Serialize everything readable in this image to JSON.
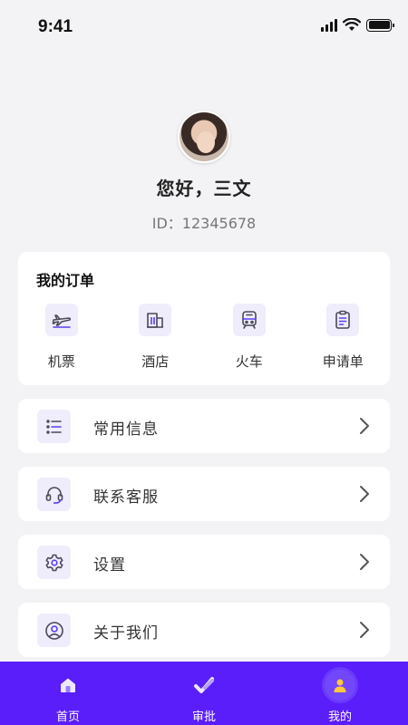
{
  "status_bar": {
    "time": "9:41"
  },
  "profile": {
    "greeting": "您好，三文",
    "id_text": "ID：12345678"
  },
  "orders": {
    "title": "我的订单",
    "items": [
      {
        "label": "机票",
        "icon": "airplane-icon"
      },
      {
        "label": "酒店",
        "icon": "hotel-building-icon"
      },
      {
        "label": "火车",
        "icon": "train-icon"
      },
      {
        "label": "申请单",
        "icon": "clipboard-icon"
      }
    ]
  },
  "menu": [
    {
      "label": "常用信息",
      "icon": "list-icon"
    },
    {
      "label": "联系客服",
      "icon": "headset-icon"
    },
    {
      "label": "设置",
      "icon": "gear-icon"
    },
    {
      "label": "关于我们",
      "icon": "user-circle-icon"
    }
  ],
  "tabs": [
    {
      "label": "首页",
      "icon": "home-icon",
      "active": false
    },
    {
      "label": "审批",
      "icon": "approve-check-icon",
      "active": false
    },
    {
      "label": "我的",
      "icon": "user-icon",
      "active": true
    }
  ],
  "colors": {
    "accent": "#5a1efb",
    "icon_bg": "#efedfb",
    "icon_stroke": "#4a4a5a",
    "icon_accent": "#5b3ef5"
  }
}
